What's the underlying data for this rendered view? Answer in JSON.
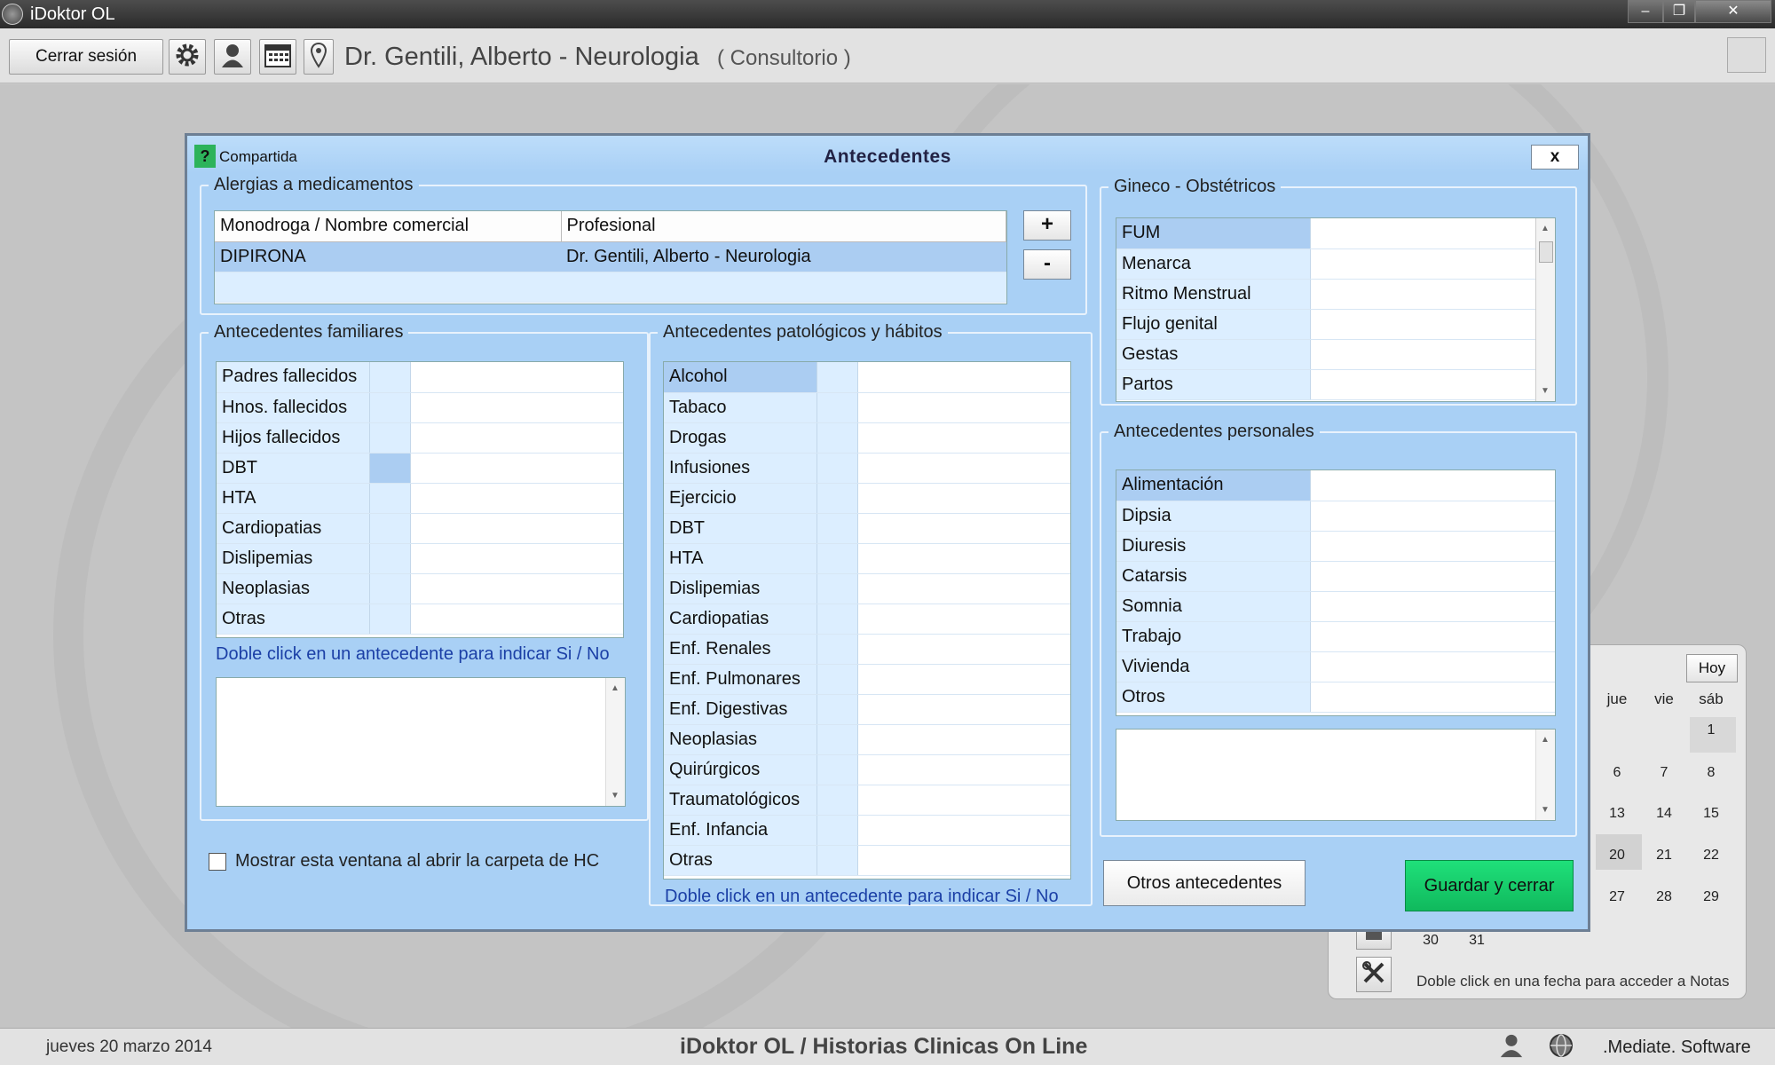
{
  "window": {
    "title": "iDoktor OL",
    "minimize": "‒",
    "restore": "❐",
    "close": "✕"
  },
  "toolbar": {
    "logout_label": "Cerrar sesión",
    "doctor_name": "Dr. Gentili, Alberto - Neurologia",
    "location": "( Consultorio )",
    "icons": [
      "gear-icon",
      "user-icon",
      "calendar-icon",
      "map-pin-icon"
    ]
  },
  "dialog": {
    "help_label": "?",
    "shared_label": "Compartida",
    "title": "Antecedentes",
    "close_label": "x",
    "allergies": {
      "legend": "Alergias a medicamentos",
      "columns": [
        "Monodroga / Nombre comercial",
        "Profesional"
      ],
      "rows": [
        {
          "drug": "DIPIRONA",
          "professional": "Dr. Gentili, Alberto - Neurologia"
        }
      ],
      "add_label": "+",
      "remove_label": "-"
    },
    "family": {
      "legend": "Antecedentes familiares",
      "items": [
        "Padres fallecidos",
        "Hnos. fallecidos",
        "Hijos fallecidos",
        "DBT",
        "HTA",
        "Cardiopatias",
        "Dislipemias",
        "Neoplasias",
        "Otras"
      ],
      "hint": "Doble click en un antecedente para indicar Si / No"
    },
    "pathological": {
      "legend": "Antecedentes patológicos y hábitos",
      "items": [
        "Alcohol",
        "Tabaco",
        "Drogas",
        "Infusiones",
        "Ejercicio",
        "DBT",
        "HTA",
        "Dislipemias",
        "Cardiopatias",
        "Enf. Renales",
        "Enf. Pulmonares",
        "Enf. Digestivas",
        "Neoplasias",
        "Quirúrgicos",
        "Traumatológicos",
        "Enf. Infancia",
        "Otras"
      ],
      "hint": "Doble click en un antecedente para indicar Si / No"
    },
    "gyneco": {
      "legend": "Gineco - Obstétricos",
      "items": [
        "FUM",
        "Menarca",
        "Ritmo Menstrual",
        "Flujo genital",
        "Gestas",
        "Partos"
      ]
    },
    "personal": {
      "legend": "Antecedentes personales",
      "items": [
        "Alimentación",
        "Dipsia",
        "Diuresis",
        "Catarsis",
        "Somnia",
        "Trabajo",
        "Vivienda",
        "Otros"
      ]
    },
    "show_on_open_label": "Mostrar esta ventana al abrir la carpeta de HC",
    "other_button": "Otros antecedentes",
    "save_button": "Guardar y cerrar"
  },
  "calendar": {
    "today_label": "Hoy",
    "weekdays": [
      "jue",
      "vie",
      "sáb"
    ],
    "rows": [
      [
        "",
        "",
        "1"
      ],
      [
        "6",
        "7",
        "8"
      ],
      [
        "13",
        "14",
        "15"
      ],
      [
        "20",
        "21",
        "22"
      ],
      [
        "27",
        "28",
        "29"
      ]
    ],
    "last_row": [
      "30",
      "31"
    ],
    "hint": "Doble click en una fecha para acceder a Notas"
  },
  "status": {
    "date": "jueves 20 marzo 2014",
    "app": "iDoktor OL  /  Historias Clinicas On Line",
    "vendor": ".Mediate. Software"
  },
  "colors": {
    "dialog_bg": "#a9d0f5",
    "selected_row": "#abcdf2",
    "save_button": "#14c868",
    "hint_text": "#1b3fa6"
  }
}
